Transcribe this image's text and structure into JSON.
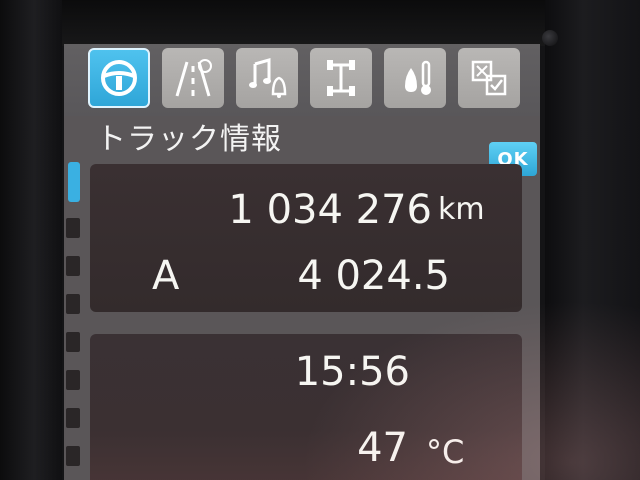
{
  "screen": {
    "title": "トラック情報",
    "ok_label": "OK"
  },
  "tabs": [
    {
      "icon": "steering-wheel-icon",
      "active": true
    },
    {
      "icon": "road-lanes-icon",
      "active": false
    },
    {
      "icon": "music-bell-icon",
      "active": false
    },
    {
      "icon": "truck-axle-icon",
      "active": false
    },
    {
      "icon": "fluid-temperature-icon",
      "active": false
    },
    {
      "icon": "settings-check-icon",
      "active": false
    }
  ],
  "odometer": {
    "value": "1 034 276",
    "unit": "km"
  },
  "trip": {
    "letter": "A",
    "value": "4 024.5"
  },
  "clock": {
    "time": "15:56"
  },
  "temperature": {
    "value": "47",
    "unit": "°C"
  },
  "colors": {
    "accent": "#2fa6d8",
    "panel": "#3a3032",
    "text": "#f6f6f2"
  }
}
